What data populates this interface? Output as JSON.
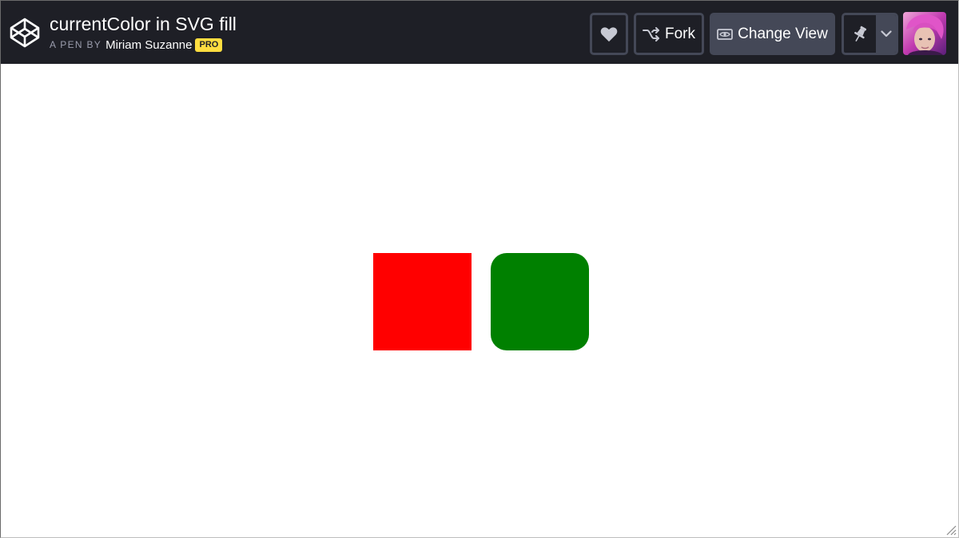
{
  "header": {
    "logo_icon": "codepen-logo-icon",
    "title": "currentColor in SVG fill",
    "byline_prefix": "A PEN BY",
    "author": "Miriam Suzanne",
    "author_badge": "PRO",
    "background_color": "#1e1f26",
    "badge_color": "#ffdd40"
  },
  "toolbar": {
    "heart_icon": "heart-icon",
    "fork_icon": "fork-icon",
    "fork_label": "Fork",
    "change_view_icon": "eye-icon",
    "change_view_label": "Change View",
    "pin_icon": "pin-icon",
    "pin_menu_icon": "chevron-down-icon",
    "avatar": "user-avatar"
  },
  "preview": {
    "shapes": [
      {
        "name": "red-square",
        "color": "#ff0000",
        "corners": "square"
      },
      {
        "name": "green-rounded-square",
        "color": "#008000",
        "corners": "rounded"
      }
    ],
    "resize_icon": "resize-grip-icon"
  }
}
